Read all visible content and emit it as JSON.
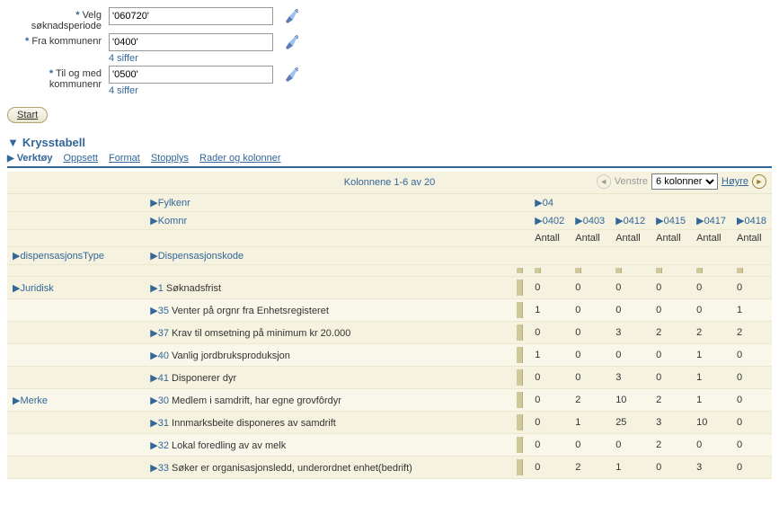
{
  "form": {
    "period": {
      "label": "Velg søknadsperiode",
      "value": "'060720'"
    },
    "from": {
      "label": "Fra kommunenr",
      "value": "'0400'",
      "hint": "4 siffer"
    },
    "to": {
      "label": "Til og med kommunenr",
      "value": "'0500'",
      "hint": "4 siffer"
    },
    "start": "Start"
  },
  "section": {
    "title": "Krysstabell"
  },
  "toolbar": {
    "verktoy": "Verktøy",
    "oppsett": "Oppsett",
    "format": "Format",
    "stopplys": "Stopplys",
    "rader": "Rader og kolonner"
  },
  "pager": {
    "range": "Kolonnene 1-6 av 20",
    "left": "Venstre",
    "right": "Høyre",
    "select": "6 kolonner"
  },
  "headers": {
    "fylkenr": "Fylkenr",
    "fylkenr_val": "04",
    "komnr": "Komnr",
    "kom": [
      "0402",
      "0403",
      "0412",
      "0415",
      "0417",
      "0418"
    ],
    "antall": "Antall",
    "dispType": "dispensasjonsType",
    "dispKode": "Dispensasjonskode"
  },
  "groups": [
    {
      "type": "Juridisk",
      "rows": [
        {
          "code": "1",
          "desc": "Søknadsfrist",
          "v": [
            0,
            0,
            0,
            0,
            0,
            0
          ]
        },
        {
          "code": "35",
          "desc": "Venter på orgnr fra Enhetsregisteret",
          "v": [
            1,
            0,
            0,
            0,
            0,
            1
          ]
        },
        {
          "code": "37",
          "desc": "Krav til omsetning på minimum kr 20.000",
          "v": [
            0,
            0,
            3,
            2,
            2,
            2
          ]
        },
        {
          "code": "40",
          "desc": "Vanlig jordbruksproduksjon",
          "v": [
            1,
            0,
            0,
            0,
            1,
            0
          ]
        },
        {
          "code": "41",
          "desc": "Disponerer dyr",
          "v": [
            0,
            0,
            3,
            0,
            1,
            0
          ]
        }
      ]
    },
    {
      "type": "Merke",
      "rows": [
        {
          "code": "30",
          "desc": "Medlem i samdrift, har egne grovfôrdyr",
          "v": [
            0,
            2,
            10,
            2,
            1,
            0
          ]
        },
        {
          "code": "31",
          "desc": "Innmarksbeite disponeres av samdrift",
          "v": [
            0,
            1,
            25,
            3,
            10,
            0
          ]
        },
        {
          "code": "32",
          "desc": "Lokal foredling av av melk",
          "v": [
            0,
            0,
            0,
            2,
            0,
            0
          ]
        },
        {
          "code": "33",
          "desc": "Søker er organisasjonsledd, underordnet enhet(bedrift)",
          "v": [
            0,
            2,
            1,
            0,
            3,
            0
          ]
        }
      ]
    }
  ]
}
